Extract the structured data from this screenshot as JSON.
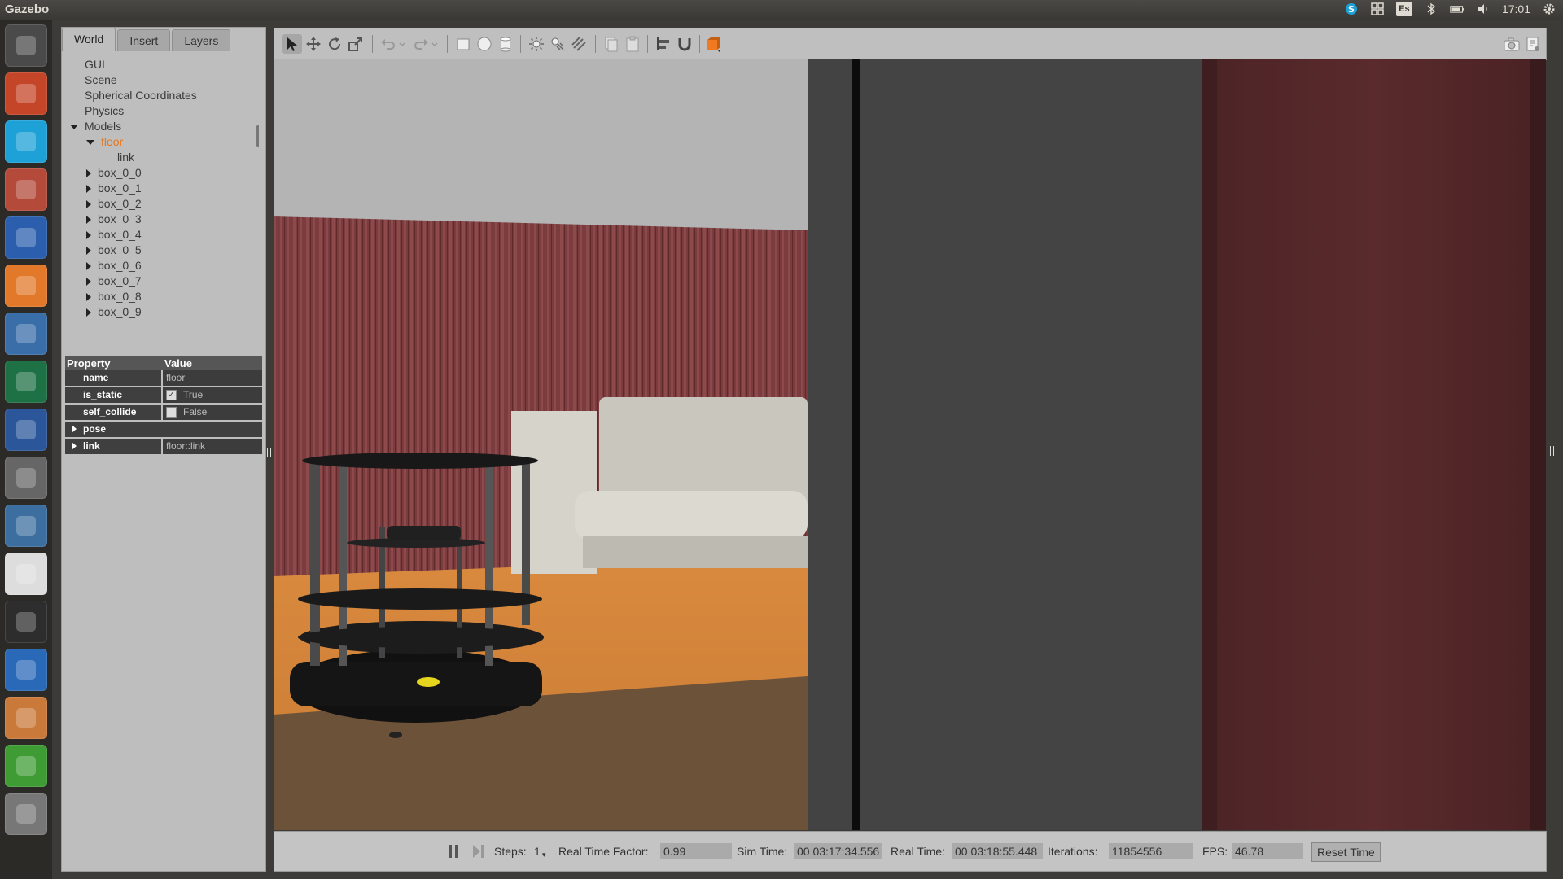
{
  "topbar": {
    "title": "Gazebo",
    "keyboard_layout": "Es",
    "clock": "17:01"
  },
  "launcher": {
    "apps": [
      {
        "name": "ubuntu-dash",
        "color": "#4a4a4a"
      },
      {
        "name": "powerpoint",
        "color": "#c44527"
      },
      {
        "name": "skype",
        "color": "#1da1d6"
      },
      {
        "name": "file-manager",
        "color": "#b34a3a"
      },
      {
        "name": "firefox",
        "color": "#2b5fad"
      },
      {
        "name": "software-center",
        "color": "#e2792a"
      },
      {
        "name": "photos",
        "color": "#3a6ea8"
      },
      {
        "name": "excel",
        "color": "#1e7145"
      },
      {
        "name": "word",
        "color": "#2b579a"
      },
      {
        "name": "system-settings",
        "color": "#666"
      },
      {
        "name": "matlab",
        "color": "#3c6f9f"
      },
      {
        "name": "foxit-reader",
        "color": "#ddd"
      },
      {
        "name": "terminal",
        "color": "#2d2d2d"
      },
      {
        "name": "media-player",
        "color": "#2a69b8"
      },
      {
        "name": "virtualbox",
        "color": "#c9793a"
      },
      {
        "name": "calc-spreadsheet",
        "color": "#3f9c35"
      },
      {
        "name": "workspace-stack",
        "color": "#777"
      }
    ]
  },
  "left_panel": {
    "tabs": [
      "World",
      "Insert",
      "Layers"
    ],
    "tree": {
      "top_items": [
        "GUI",
        "Scene",
        "Spherical Coordinates",
        "Physics"
      ],
      "models_label": "Models",
      "floor_label": "floor",
      "link_label": "link",
      "boxes": [
        "box_0_0",
        "box_0_1",
        "box_0_2",
        "box_0_3",
        "box_0_4",
        "box_0_5",
        "box_0_6",
        "box_0_7",
        "box_0_8",
        "box_0_9"
      ]
    },
    "properties": {
      "header_property": "Property",
      "header_value": "Value",
      "name_key": "name",
      "name_value": "floor",
      "static_key": "is_static",
      "static_value": "True",
      "collide_key": "self_collide",
      "collide_value": "False",
      "pose_key": "pose",
      "link_key": "link",
      "link_value": "floor::link"
    }
  },
  "bottombar": {
    "steps_label": "Steps:",
    "steps_value": "1",
    "rtf_label": "Real Time Factor:",
    "rtf_value": "0.99",
    "sim_label": "Sim Time:",
    "sim_value": "00 03:17:34.556",
    "real_label": "Real Time:",
    "real_value": "00 03:18:55.448",
    "iter_label": "Iterations:",
    "iter_value": "11854556",
    "fps_label": "FPS:",
    "fps_value": "46.78",
    "reset_label": "Reset Time"
  },
  "colors": {
    "accent_selected": "#e8761a",
    "panel_bg": "#bebebe",
    "toolbar_orange": "#f07a21"
  }
}
